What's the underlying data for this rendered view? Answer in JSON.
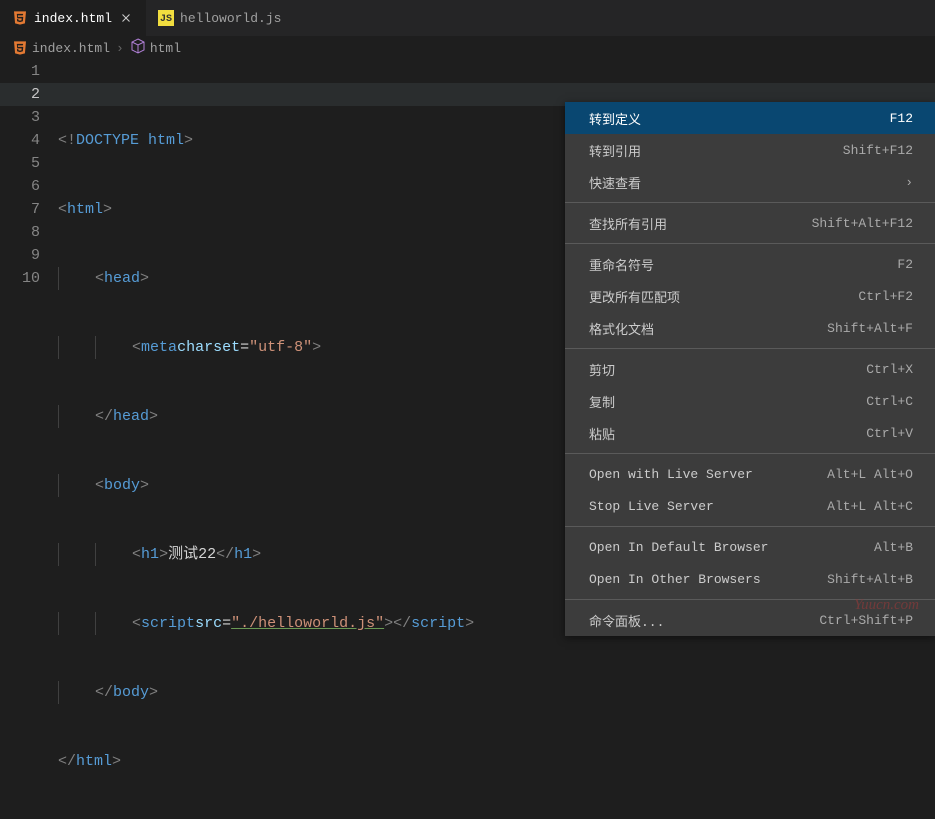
{
  "tabs": [
    {
      "icon": "html5",
      "label": "index.html",
      "active": true
    },
    {
      "icon": "js",
      "label": "helloworld.js",
      "active": false
    }
  ],
  "breadcrumbs": [
    {
      "icon": "html5",
      "label": "index.html"
    },
    {
      "icon": "cube",
      "label": "html"
    }
  ],
  "code_lines": {
    "count": 10,
    "current_line": 2,
    "l1_doctype": "DOCTYPE html",
    "l1_html_open": "html",
    "l1_html_close": "html",
    "head_open": "head",
    "head_close": "head",
    "meta": "meta",
    "charset_attr": "charset",
    "charset_val": "\"utf-8\"",
    "body_open": "body",
    "body_close": "body",
    "h1": "h1",
    "h1_text": "测试22",
    "script": "script",
    "src_attr": "src",
    "src_val": "\"./helloworld.js\""
  },
  "context_menu": {
    "groups": [
      [
        {
          "label": "转到定义",
          "shortcut": "F12",
          "highlighted": true
        },
        {
          "label": "转到引用",
          "shortcut": "Shift+F12"
        },
        {
          "label": "快速查看",
          "submenu": true
        }
      ],
      [
        {
          "label": "查找所有引用",
          "shortcut": "Shift+Alt+F12"
        }
      ],
      [
        {
          "label": "重命名符号",
          "shortcut": "F2"
        },
        {
          "label": "更改所有匹配项",
          "shortcut": "Ctrl+F2"
        },
        {
          "label": "格式化文档",
          "shortcut": "Shift+Alt+F"
        }
      ],
      [
        {
          "label": "剪切",
          "shortcut": "Ctrl+X"
        },
        {
          "label": "复制",
          "shortcut": "Ctrl+C"
        },
        {
          "label": "粘贴",
          "shortcut": "Ctrl+V"
        }
      ],
      [
        {
          "label": "Open with Live Server",
          "shortcut": "Alt+L Alt+O"
        },
        {
          "label": "Stop Live Server",
          "shortcut": "Alt+L Alt+C"
        }
      ],
      [
        {
          "label": "Open In Default Browser",
          "shortcut": "Alt+B"
        },
        {
          "label": "Open In Other Browsers",
          "shortcut": "Shift+Alt+B"
        }
      ],
      [
        {
          "label": "命令面板...",
          "shortcut": "Ctrl+Shift+P"
        }
      ]
    ]
  },
  "watermark": "Yuucn.com"
}
